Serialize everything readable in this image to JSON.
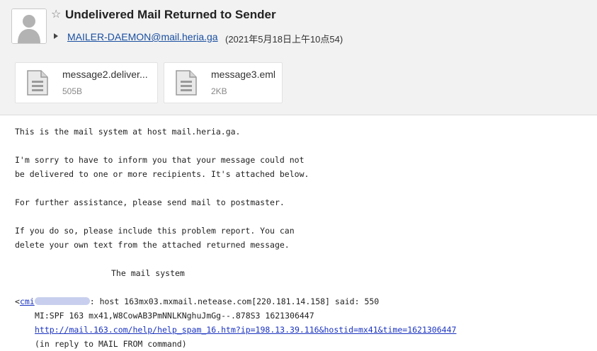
{
  "header": {
    "subject": "Undelivered Mail Returned to Sender",
    "sender": "MAILER-DAEMON@mail.heria.ga",
    "date": "(2021年5月18日上午10点54)",
    "icons": [
      "avatar-icon",
      "star-icon",
      "expand-triangle-icon"
    ]
  },
  "attachments": [
    {
      "name": "message2.deliver...",
      "size": "505B",
      "icon": "file-icon"
    },
    {
      "name": "message3.eml",
      "size": "2KB",
      "icon": "file-icon"
    }
  ],
  "body": {
    "l1": "This is the mail system at host mail.heria.ga.",
    "l2": "I'm sorry to have to inform you that your message could not",
    "l3": "be delivered to one or more recipients. It's attached below.",
    "l4": "For further assistance, please send mail to postmaster.",
    "l5": "If you do so, please include this problem report. You can",
    "l6": "delete your own text from the attached returned message.",
    "l7": "The mail system",
    "l8_prefix": "<",
    "l8_link": "cmi",
    "l8_rest": ": host 163mx03.mxmail.netease.com[220.181.14.158] said: 550",
    "l9": "MI:SPF 163 mx41,W8CowAB3PmNNLKNghuJmGg--.878S3 1621306447",
    "l10_link": "http://mail.163.com/help/help_spam_16.htm?ip=198.13.39.116&hostid=mx41&time=1621306447",
    "l11": "(in reply to MAIL FROM command)"
  }
}
